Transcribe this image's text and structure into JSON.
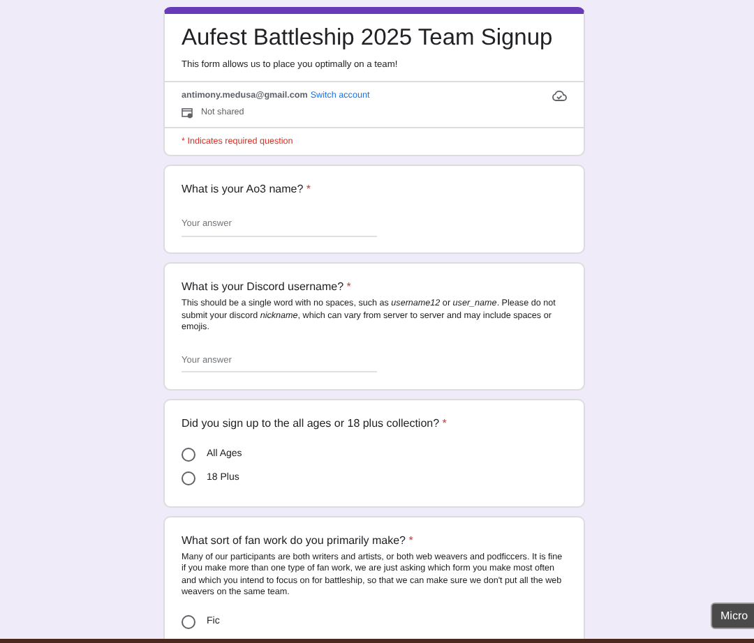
{
  "header": {
    "title": "Aufest Battleship 2025 Team Signup",
    "description": "This form allows us to place you optimally on a team!",
    "account": "antimony.medusa@gmail.com",
    "switch_link": "Switch account",
    "sharing": "Not shared",
    "required_note": "* Indicates required question"
  },
  "questions": [
    {
      "kind": "text",
      "title": "What is your Ao3 name?",
      "required_mark": "*",
      "placeholder": "Your answer"
    },
    {
      "kind": "text",
      "title": "What is your Discord username?",
      "required_mark": "*",
      "help": "This should be a single word with no spaces, such as *username12* or *user_name*. Please do not submit your discord *nickname*, which can vary from server to server and may include spaces or emojis.",
      "placeholder": "Your answer"
    },
    {
      "kind": "radio",
      "title": "Did you sign up to the all ages or 18 plus collection?",
      "required_mark": "*",
      "options": [
        {
          "label": "All Ages",
          "selected": false
        },
        {
          "label": "18 Plus",
          "selected": false
        }
      ]
    },
    {
      "kind": "radio",
      "title": "What sort of fan work do you primarily make?",
      "required_mark": "*",
      "help": "Many of our participants are both writers and artists, or both web weavers and podficcers. It is fine if you make more than one type of fan work, we are just asking which form you make most often and which you intend to focus on for battleship, so that we can make sure we don't put all the web weavers on the same team.",
      "options": [
        {
          "label": "Fic",
          "selected": false
        }
      ]
    }
  ],
  "tooltip": "Micro"
}
